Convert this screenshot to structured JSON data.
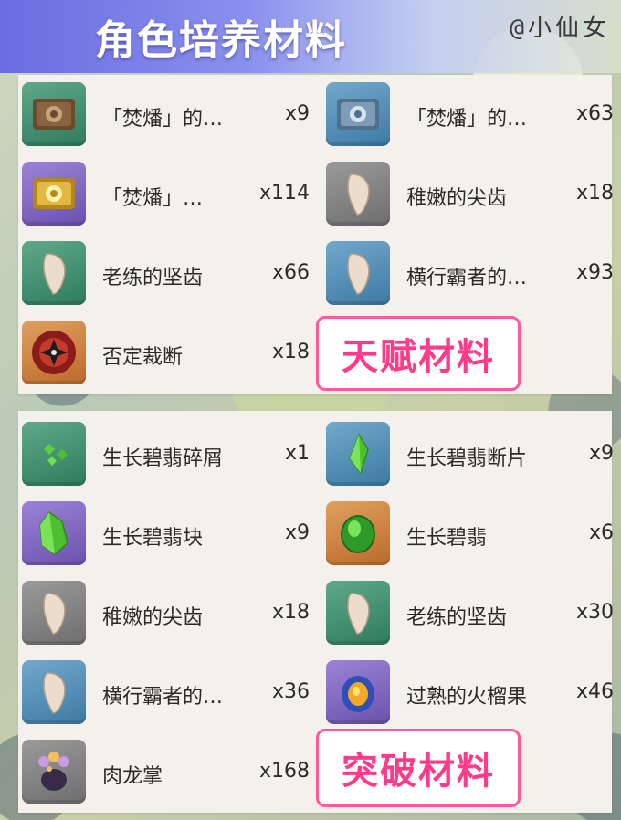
{
  "header": {
    "title": "角色培养材料",
    "watermark": "@小仙女"
  },
  "talent": {
    "label": "天赋材料",
    "items": [
      {
        "name": "「焚燔」的…",
        "count": "x9",
        "icon": "scroll-bronze-icon",
        "rarity_color": "#3f8f6e"
      },
      {
        "name": "「焚燔」的…",
        "count": "x63",
        "icon": "scroll-silver-icon",
        "rarity_color": "#4a88b5"
      },
      {
        "name": "「焚燔」…",
        "count": "x114",
        "icon": "scroll-gold-icon",
        "rarity_color": "#7b63c2"
      },
      {
        "name": "稚嫩的尖齿",
        "count": "x18",
        "icon": "fang-icon",
        "rarity_color": "#808080"
      },
      {
        "name": "老练的坚齿",
        "count": "x66",
        "icon": "fang-icon",
        "rarity_color": "#3f8f6e"
      },
      {
        "name": "横行霸者的…",
        "count": "x93",
        "icon": "fang-icon",
        "rarity_color": "#4a88b5"
      },
      {
        "name": "否定裁断",
        "count": "x18",
        "icon": "boss-drop-icon",
        "rarity_color": "#c77a3a"
      }
    ]
  },
  "ascend": {
    "label": "突破材料",
    "items": [
      {
        "name": "生长碧翡碎屑",
        "count": "x1",
        "icon": "jade-sliver-icon",
        "rarity_color": "#3f8f6e"
      },
      {
        "name": "生长碧翡断片",
        "count": "x9",
        "icon": "jade-fragment-icon",
        "rarity_color": "#4a88b5"
      },
      {
        "name": "生长碧翡块",
        "count": "x9",
        "icon": "jade-chunk-icon",
        "rarity_color": "#7b63c2"
      },
      {
        "name": "生长碧翡",
        "count": "x6",
        "icon": "jade-gemstone-icon",
        "rarity_color": "#c77a3a"
      },
      {
        "name": "稚嫩的尖齿",
        "count": "x18",
        "icon": "fang-icon",
        "rarity_color": "#808080"
      },
      {
        "name": "老练的坚齿",
        "count": "x30",
        "icon": "fang-icon",
        "rarity_color": "#3f8f6e"
      },
      {
        "name": "横行霸者的…",
        "count": "x36",
        "icon": "fang-icon",
        "rarity_color": "#4a88b5"
      },
      {
        "name": "过熟的火榴果",
        "count": "x46",
        "icon": "fruit-icon",
        "rarity_color": "#7b63c2"
      },
      {
        "name": "肉龙掌",
        "count": "x168",
        "icon": "dragon-paw-icon",
        "rarity_color": "#808080"
      }
    ]
  }
}
